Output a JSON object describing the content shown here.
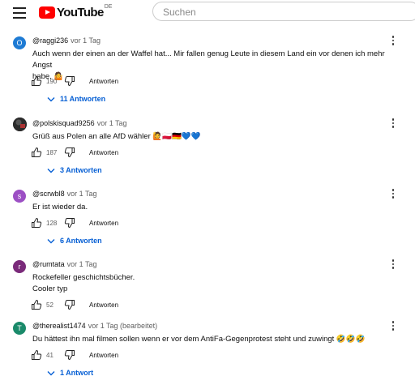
{
  "header": {
    "logo_text": "YouTube",
    "logo_region": "DE",
    "search_placeholder": "Suchen"
  },
  "comments": [
    {
      "author": "@raggi236",
      "time": "vor 1 Tag",
      "avatar_letter": "O",
      "avatar_color": "#1e7bd4",
      "text_line1": "Auch wenn der einen an der Waffel hat... Mir fallen genug Leute in diesem Land ein vor denen ich mehr Angst",
      "text_line2": "habe. 🤷",
      "likes": "190",
      "reply_label": "Antworten",
      "replies_label": "11 Antworten"
    },
    {
      "author": "@polskisquad9256",
      "time": "vor 1 Tag",
      "avatar_letter": "",
      "avatar_color": "#2b2b2b",
      "text_line1": "Grüß aus Polen an alle AfD wähler 🙋🇵🇱🇩🇪💙💙",
      "likes": "187",
      "reply_label": "Antworten",
      "replies_label": "3 Antworten"
    },
    {
      "author": "@scrwbl8",
      "time": "vor 1 Tag",
      "avatar_letter": "s",
      "avatar_color": "#9c4fc4",
      "text_line1": "Er ist wieder da.",
      "likes": "128",
      "reply_label": "Antworten",
      "replies_label": "6 Antworten"
    },
    {
      "author": "@rumtata",
      "time": "vor 1 Tag",
      "avatar_letter": "r",
      "avatar_color": "#7a2a7a",
      "text_line1": "Rockefeller geschichtsbücher.",
      "text_line2": "Cooler typ",
      "likes": "52",
      "reply_label": "Antworten"
    },
    {
      "author": "@therealist1474",
      "time": "vor 1 Tag (bearbeitet)",
      "avatar_letter": "T",
      "avatar_color": "#1a8a6a",
      "text_line1": "Du hättest ihn mal filmen sollen wenn er vor dem AntiFa-Gegenprotest steht und zuwingt 🤣🤣🤣",
      "likes": "41",
      "reply_label": "Antworten",
      "replies_label": "1 Antwort"
    }
  ]
}
